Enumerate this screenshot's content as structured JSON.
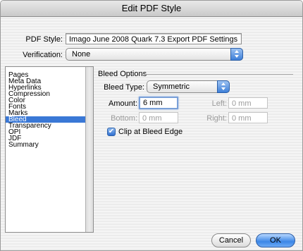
{
  "window": {
    "title": "Edit PDF Style"
  },
  "pdf_style": {
    "label": "PDF Style:",
    "value": "Imago June 2008 Quark 7.3 Export PDF Settings"
  },
  "verification": {
    "label": "Verification:",
    "value": "None"
  },
  "sidebar": {
    "items": [
      {
        "label": "Pages",
        "selected": false
      },
      {
        "label": "Meta Data",
        "selected": false
      },
      {
        "label": "Hyperlinks",
        "selected": false
      },
      {
        "label": "Compression",
        "selected": false
      },
      {
        "label": "Color",
        "selected": false
      },
      {
        "label": "Fonts",
        "selected": false
      },
      {
        "label": "Marks",
        "selected": false
      },
      {
        "label": "Bleed",
        "selected": true
      },
      {
        "label": "Transparency",
        "selected": false
      },
      {
        "label": "OPI",
        "selected": false
      },
      {
        "label": "JDF",
        "selected": false
      },
      {
        "label": "Summary",
        "selected": false
      }
    ]
  },
  "bleed": {
    "group_title": "Bleed Options",
    "type_label": "Bleed Type:",
    "type_value": "Symmetric",
    "amount_label": "Amount:",
    "amount_value": "6 mm",
    "left_label": "Left:",
    "left_value": "0 mm",
    "bottom_label": "Bottom:",
    "bottom_value": "0 mm",
    "right_label": "Right:",
    "right_value": "0 mm",
    "clip_label": "Clip at Bleed Edge",
    "clip_checked": true
  },
  "buttons": {
    "cancel": "Cancel",
    "ok": "OK"
  },
  "icons": {
    "checkmark": "✔",
    "popup": "up-down-arrows-icon"
  },
  "colors": {
    "selection": "#3a78d6",
    "accent_blue": "#3e7fd8"
  }
}
